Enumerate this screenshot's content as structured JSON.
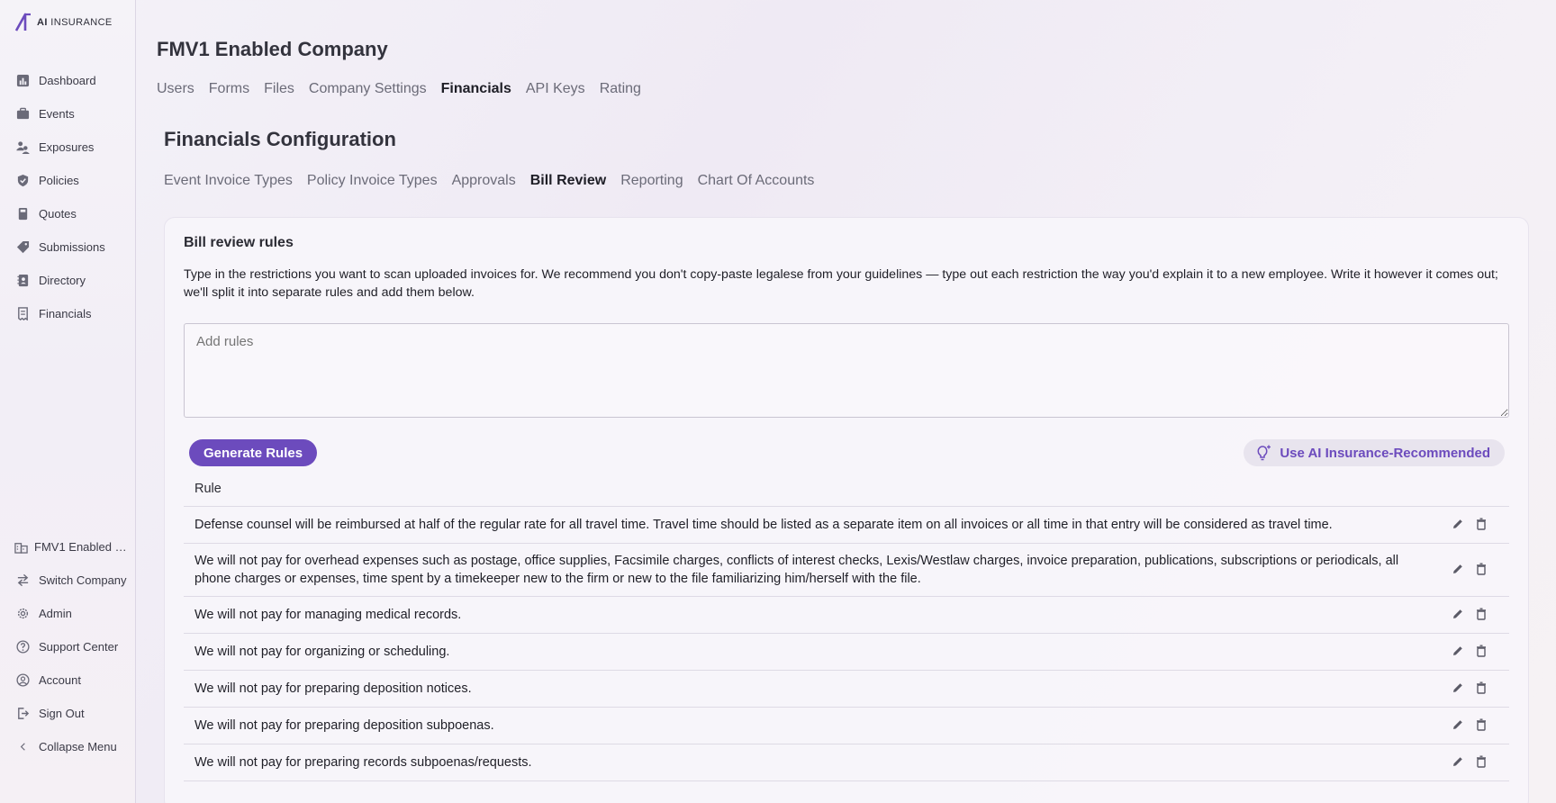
{
  "brand": {
    "name_bold": "AI",
    "name_rest": " INSURANCE",
    "accent": "#6c4bbd"
  },
  "sidebar": {
    "items": [
      {
        "label": "Dashboard",
        "icon": "chart-icon"
      },
      {
        "label": "Events",
        "icon": "briefcase-icon"
      },
      {
        "label": "Exposures",
        "icon": "people-icon"
      },
      {
        "label": "Policies",
        "icon": "shield-icon"
      },
      {
        "label": "Quotes",
        "icon": "calculator-icon"
      },
      {
        "label": "Submissions",
        "icon": "tag-icon"
      },
      {
        "label": "Directory",
        "icon": "address-book-icon"
      },
      {
        "label": "Financials",
        "icon": "receipt-icon"
      }
    ],
    "bottom": [
      {
        "label": "FMV1 Enabled Company",
        "icon": "building-icon"
      },
      {
        "label": "Switch Company",
        "icon": "switch-icon"
      },
      {
        "label": "Admin",
        "icon": "gear-icon"
      },
      {
        "label": "Support Center",
        "icon": "question-icon"
      },
      {
        "label": "Account",
        "icon": "user-circle-icon"
      },
      {
        "label": "Sign Out",
        "icon": "sign-out-icon"
      },
      {
        "label": "Collapse Menu",
        "icon": "chevron-left-icon"
      }
    ]
  },
  "header": {
    "title": "FMV1 Enabled Company",
    "tabs": [
      "Users",
      "Forms",
      "Files",
      "Company Settings",
      "Financials",
      "API Keys",
      "Rating"
    ],
    "active_tab": "Financials"
  },
  "section": {
    "title": "Financials Configuration",
    "tabs": [
      "Event Invoice Types",
      "Policy Invoice Types",
      "Approvals",
      "Bill Review",
      "Reporting",
      "Chart Of Accounts"
    ],
    "active_tab": "Bill Review"
  },
  "card": {
    "title": "Bill review rules",
    "description": "Type in the restrictions you want to scan uploaded invoices for. We recommend you don't copy-paste legalese from your guidelines — type out each restriction the way you'd explain it to a new employee. Write it however it comes out; we'll split it into separate rules and add them below.",
    "input_placeholder": "Add rules",
    "input_value": "",
    "generate_label": "Generate Rules",
    "recommended_label": "Use AI Insurance-Recommended"
  },
  "table": {
    "header": "Rule",
    "rows": [
      "Defense counsel will be reimbursed at half of the regular rate for all travel time. Travel time should be listed as a separate item on all invoices or all time in that entry will be considered as travel time.",
      "We will not pay for overhead expenses such as postage, office supplies, Facsimile charges, conflicts of interest checks, Lexis/Westlaw charges, invoice preparation, publications, subscriptions or periodicals, all phone charges or expenses, time spent by a timekeeper new to the firm or new to the file familiarizing him/herself with the file.",
      "We will not pay for managing medical records.",
      "We will not pay for organizing or scheduling.",
      "We will not pay for preparing deposition notices.",
      "We will not pay for preparing deposition subpoenas.",
      "We will not pay for preparing records subpoenas/requests."
    ]
  }
}
